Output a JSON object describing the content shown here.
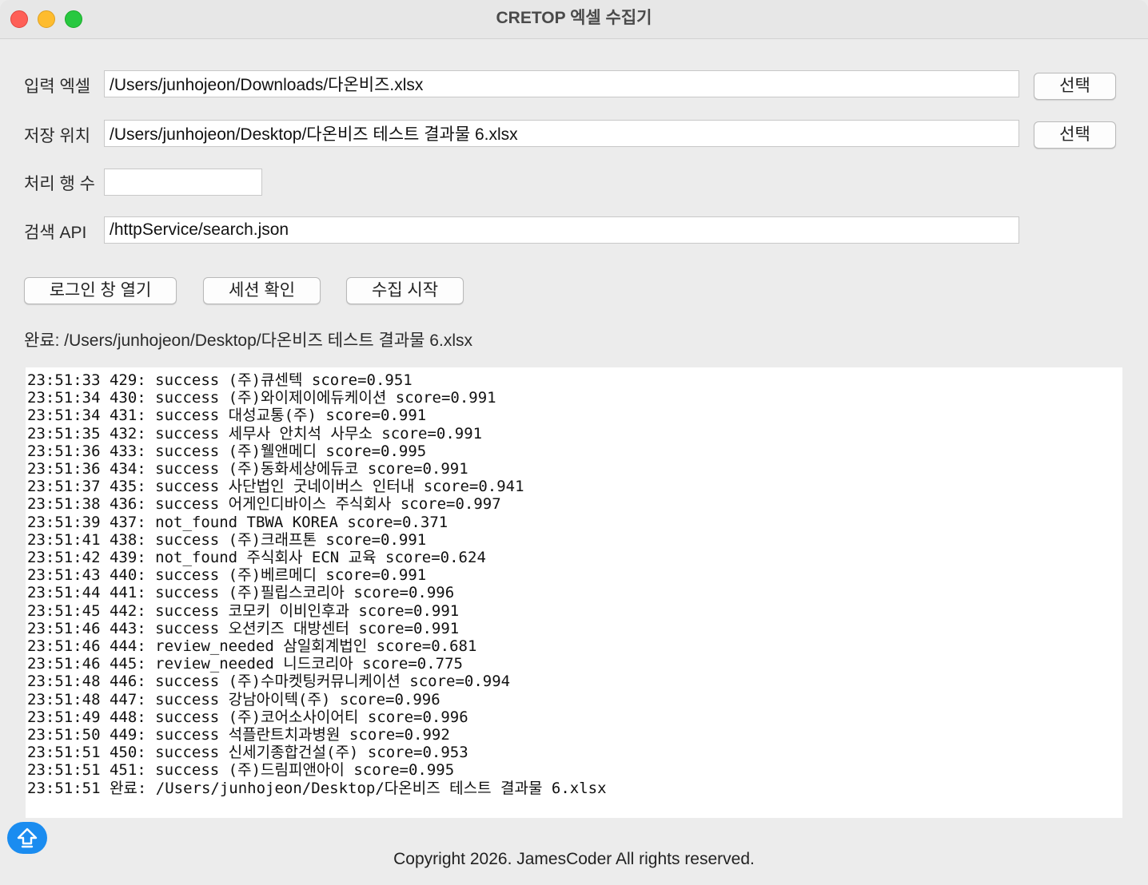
{
  "window": {
    "title": "CRETOP 엑셀 수집기"
  },
  "form": {
    "input_label": "입력 엑셀",
    "input_value": "/Users/junhojeon/Downloads/다온비즈.xlsx",
    "output_label": "저장 위치",
    "output_value": "/Users/junhojeon/Desktop/다온비즈 테스트 결과물 6.xlsx",
    "rows_label": "처리 행 수",
    "rows_value": "",
    "api_label": "검색 API",
    "api_value": "/httpService/search.json",
    "select_label": "선택"
  },
  "actions": {
    "login": "로그인 창 열기",
    "session": "세션 확인",
    "start": "수집 시작"
  },
  "status": "완료: /Users/junhojeon/Desktop/다온비즈 테스트 결과물 6.xlsx",
  "log": [
    "23:51:33 429: success (주)큐센텍 score=0.951",
    "23:51:34 430: success (주)와이제이에듀케이션 score=0.991",
    "23:51:34 431: success 대성교통(주) score=0.991",
    "23:51:35 432: success 세무사 안치석 사무소 score=0.991",
    "23:51:36 433: success (주)웰앤메디 score=0.995",
    "23:51:36 434: success (주)동화세상에듀코 score=0.991",
    "23:51:37 435: success 사단법인 굿네이버스 인터내 score=0.941",
    "23:51:38 436: success 어게인디바이스 주식회사 score=0.997",
    "23:51:39 437: not_found TBWA KOREA score=0.371",
    "23:51:41 438: success (주)크래프톤 score=0.991",
    "23:51:42 439: not_found 주식회사 ECN 교육 score=0.624",
    "23:51:43 440: success (주)베르메디 score=0.991",
    "23:51:44 441: success (주)필립스코리아 score=0.996",
    "23:51:45 442: success 코모키 이비인후과 score=0.991",
    "23:51:46 443: success 오션키즈 대방센터 score=0.991",
    "23:51:46 444: review_needed 삼일회계법인 score=0.681",
    "23:51:46 445: review_needed 니드코리아 score=0.775",
    "23:51:48 446: success (주)수마켓팅커뮤니케이션 score=0.994",
    "23:51:48 447: success 강남아이텍(주) score=0.996",
    "23:51:49 448: success (주)코어소사이어티 score=0.996",
    "23:51:50 449: success 석플란트치과병원 score=0.992",
    "23:51:51 450: success 신세기종합건설(주) score=0.953",
    "23:51:51 451: success (주)드림피앤아이 score=0.995",
    "23:51:51 완료: /Users/junhojeon/Desktop/다온비즈 테스트 결과물 6.xlsx"
  ],
  "footer": "Copyright 2026. JamesCoder All rights reserved.",
  "icons": {
    "close": "close-window-icon",
    "minimize": "minimize-window-icon",
    "zoom": "zoom-window-icon",
    "scroll_top": "arrow-up-icon"
  },
  "colors": {
    "close": "#fe5f57",
    "minimize": "#febc2e",
    "zoom": "#28c840",
    "fab": "#1a8cf0"
  }
}
